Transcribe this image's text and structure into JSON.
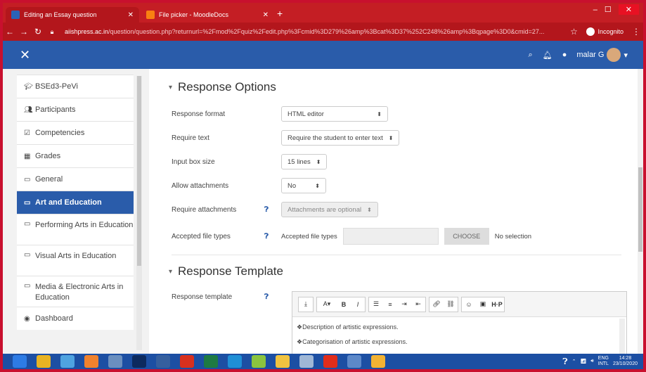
{
  "browser": {
    "tabs": [
      {
        "label": "Editing an Essay question"
      },
      {
        "label": "File picker - MoodleDocs"
      }
    ],
    "new_tab": "+",
    "window_controls": {
      "minimize": "–",
      "maximize": "☐",
      "close": "✕"
    },
    "url_host": "aiishpress.ac.in",
    "url_path": "/question/question.php?returnurl=%2Fmod%2Fquiz%2Fedit.php%3Fcmid%3D279%26amp%3Bcat%3D37%252C248%26amp%3Bqpage%3D0&cmid=27...",
    "incognito_label": "Incognito"
  },
  "navbar": {
    "close_glyph": "✕",
    "user_name": "malar G"
  },
  "sidebar": {
    "items": [
      {
        "icon": "graduation-cap",
        "label": "BSEd3-PeVi"
      },
      {
        "icon": "users",
        "label": "Participants"
      },
      {
        "icon": "checkbox",
        "label": "Competencies"
      },
      {
        "icon": "table",
        "label": "Grades"
      },
      {
        "icon": "folder",
        "label": "General"
      },
      {
        "icon": "folder",
        "label": "Art and Education",
        "active": true
      },
      {
        "icon": "folder",
        "label": "Performing Arts in Education"
      },
      {
        "icon": "folder",
        "label": "Visual Arts in Education"
      },
      {
        "icon": "folder",
        "label": "Media & Electronic Arts in Education"
      },
      {
        "icon": "dashboard",
        "label": "Dashboard"
      }
    ]
  },
  "response_options": {
    "heading": "Response Options",
    "format_label": "Response format",
    "format_value": "HTML editor",
    "require_text_label": "Require text",
    "require_text_value": "Require the student to enter text",
    "input_size_label": "Input box size",
    "input_size_value": "15 lines",
    "allow_attach_label": "Allow attachments",
    "allow_attach_value": "No",
    "require_attach_label": "Require attachments",
    "require_attach_value": "Attachments are optional",
    "file_types_label": "Accepted file types",
    "file_types_field_label": "Accepted file types",
    "choose_button": "CHOOSE",
    "no_selection": "No selection"
  },
  "response_template": {
    "heading": "Response Template",
    "label": "Response template",
    "lines": [
      "❖Description of artistic expressions.",
      "❖Categorisation of artistic expressions."
    ]
  },
  "taskbar": {
    "lang": "ENG",
    "lang2": "INTL",
    "time": "14:28",
    "date": "23/10/2020"
  }
}
